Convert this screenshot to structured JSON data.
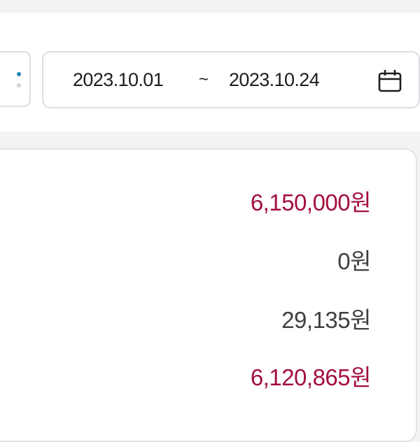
{
  "date_range": {
    "start": "2023.10.01",
    "separator": "~",
    "end": "2023.10.24",
    "icon": "calendar-icon"
  },
  "filter": {
    "icon": "more-vertical-icon"
  },
  "summary": {
    "rows": [
      {
        "amount": "6,150,000원",
        "color": "#a30f3c"
      },
      {
        "amount": "0원",
        "color": "#3f3f44"
      },
      {
        "amount": "29,135원",
        "color": "#3f3f44"
      },
      {
        "amount": "6,120,865원",
        "color": "#a30f3c"
      }
    ]
  },
  "colors": {
    "accent": "#a30f3c",
    "dot_top": "#1d87b0",
    "dot_bottom": "#cfd2d6",
    "border": "#dcdde0",
    "background": "#f3f3f4"
  }
}
